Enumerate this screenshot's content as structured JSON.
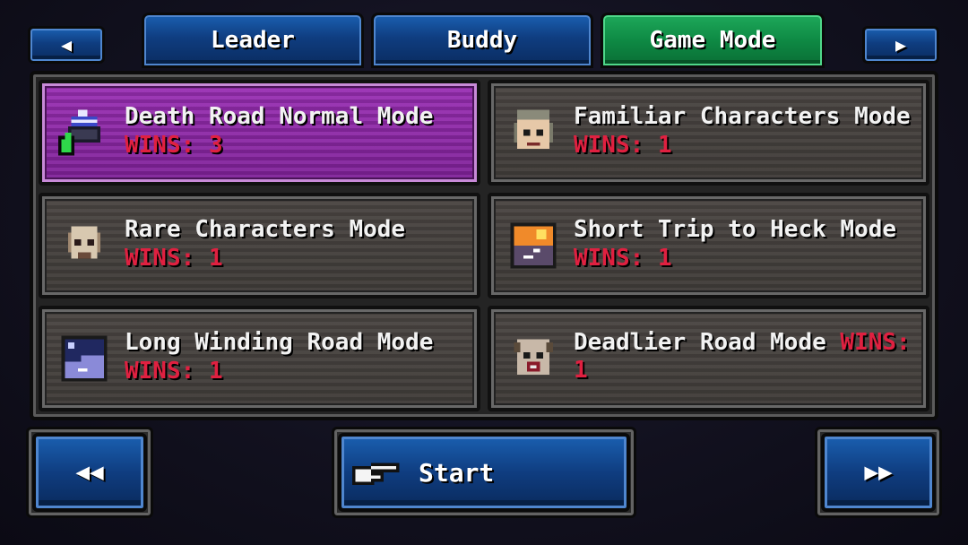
{
  "tabs": {
    "prev_icon": "◀",
    "next_icon": "▶",
    "items": [
      {
        "label": "Leader"
      },
      {
        "label": "Buddy"
      },
      {
        "label": "Game Mode"
      }
    ],
    "active": "Game Mode"
  },
  "modes": [
    {
      "title": "Death Road Normal Mode",
      "wins_label": "WINS:",
      "wins": "3",
      "icon": "beanie-thumbs-up-icon",
      "selected": true
    },
    {
      "title": "Familiar Characters Mode",
      "wins_label": "WINS:",
      "wins": "1",
      "icon": "familiar-face-icon"
    },
    {
      "title": "Rare Characters Mode",
      "wins_label": "WINS:",
      "wins": "1",
      "icon": "skull-face-icon"
    },
    {
      "title": "Short Trip to Heck Mode",
      "wins_label": "WINS:",
      "wins": "1",
      "icon": "sunset-road-icon"
    },
    {
      "title": "Long Winding Road Mode",
      "wins_label": "WINS:",
      "wins": "1",
      "icon": "night-road-icon"
    },
    {
      "title": "Deadlier Road Mode",
      "wins_label": "WINS:",
      "wins": "1",
      "icon": "zombie-face-icon"
    }
  ],
  "footer": {
    "prev_page_icon": "◀◀",
    "start_label": "Start",
    "start_icon": "pointing-hand-icon",
    "next_page_icon": "▶▶"
  },
  "colors": {
    "selected_card": "#8a27a3",
    "wins_text": "#e02040",
    "tab_blue": "#0f3d80",
    "tab_active_green": "#0e8a44"
  }
}
